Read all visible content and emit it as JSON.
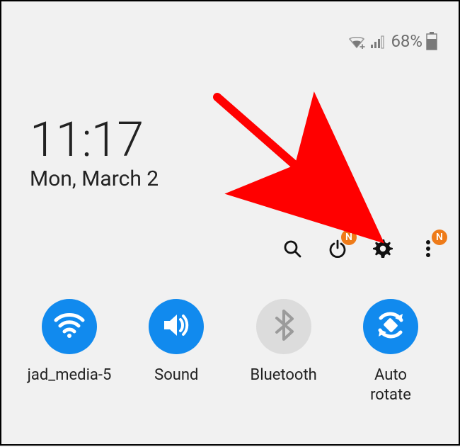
{
  "status": {
    "battery_percent": "68%"
  },
  "clock": {
    "time": "11:17",
    "date": "Mon, March 2"
  },
  "badges": {
    "power": "N",
    "more": "N"
  },
  "tiles": {
    "wifi": {
      "label": "jad_media-5",
      "on": true
    },
    "sound": {
      "label": "Sound",
      "on": true
    },
    "bluetooth": {
      "label": "Bluetooth",
      "on": false
    },
    "autorotate": {
      "label": "Auto\nrotate",
      "on": true
    }
  },
  "colors": {
    "accent": "#118aee",
    "badge": "#ee7b19",
    "arrow": "#ff0000"
  }
}
